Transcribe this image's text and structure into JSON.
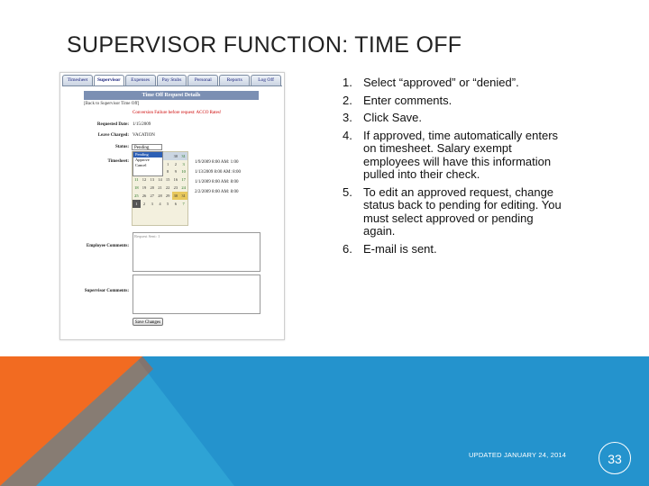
{
  "slide": {
    "title": "SUPERVISOR FUNCTION: TIME OFF",
    "footer": "UPDATED JANUARY 24, 2014",
    "page_number": "33",
    "colors": {
      "orange": "#f26b21",
      "blue": "#2ea3d5",
      "dark_blue": "#1e86c6"
    }
  },
  "screenshot": {
    "tabs": [
      "Timesheet",
      "Supervisor",
      "Expenses",
      "Pay Stubs",
      "Personal",
      "Reports",
      "Log Off"
    ],
    "active_tab": 1,
    "header": "Time Off Request Details",
    "back_link": "[Back to Supervisor Time Off]",
    "warning": "Conversion Failure before request: ACCO Rates!",
    "fields": {
      "requested_date_label": "Requested Date:",
      "requested_date": "1/15/2009",
      "leave_charged_label": "Leave Charged:",
      "leave_charged": "VACATION",
      "status_label": "Status:",
      "status_value": "Pending",
      "status_options": [
        "Pending",
        "Approve",
        "Cancel"
      ],
      "timesheet_label": "Timesheet:",
      "employee_comments_label": "Employee Comments:",
      "employee_comments_placeholder": "Request Sent: 1",
      "supervisor_comments_label": "Supervisor Comments:",
      "save_button": "Save Changes"
    },
    "calendar": {
      "weeks": [
        [
          "",
          "",
          "",
          "",
          "",
          "30",
          "31"
        ],
        [
          "28",
          "29",
          "30",
          "31",
          "1",
          "2",
          "3"
        ],
        [
          "4",
          "5",
          "6",
          "7",
          "8",
          "9",
          "10"
        ],
        [
          "11",
          "12",
          "13",
          "14",
          "15",
          "16",
          "17"
        ],
        [
          "18",
          "19",
          "20",
          "21",
          "22",
          "23",
          "24"
        ],
        [
          "25",
          "26",
          "27",
          "28",
          "29",
          "30",
          "31"
        ],
        [
          "1",
          "2",
          "3",
          "4",
          "5",
          "6",
          "7"
        ]
      ]
    },
    "entries": [
      "1/9/2009 8:00 AM: 1:00",
      "1/13/2009 8:00 AM: 8:00",
      "1/1/2009 8:00 AM: 8:00",
      "2/2/2009 8:00 AM: 8:00"
    ]
  },
  "steps": [
    {
      "num": "1.",
      "text": "Select “approved” or “denied”."
    },
    {
      "num": "2.",
      "text": "Enter comments."
    },
    {
      "num": "3.",
      "text": "Click Save."
    },
    {
      "num": "4.",
      "text": "If approved, time automatically enters on timesheet.  Salary exempt employees will have this information pulled into their check."
    },
    {
      "num": "5.",
      "text": "To edit an approved request, change status back to pending for editing.  You must select approved or pending again."
    },
    {
      "num": "6.",
      "text": "E-mail is sent."
    }
  ]
}
